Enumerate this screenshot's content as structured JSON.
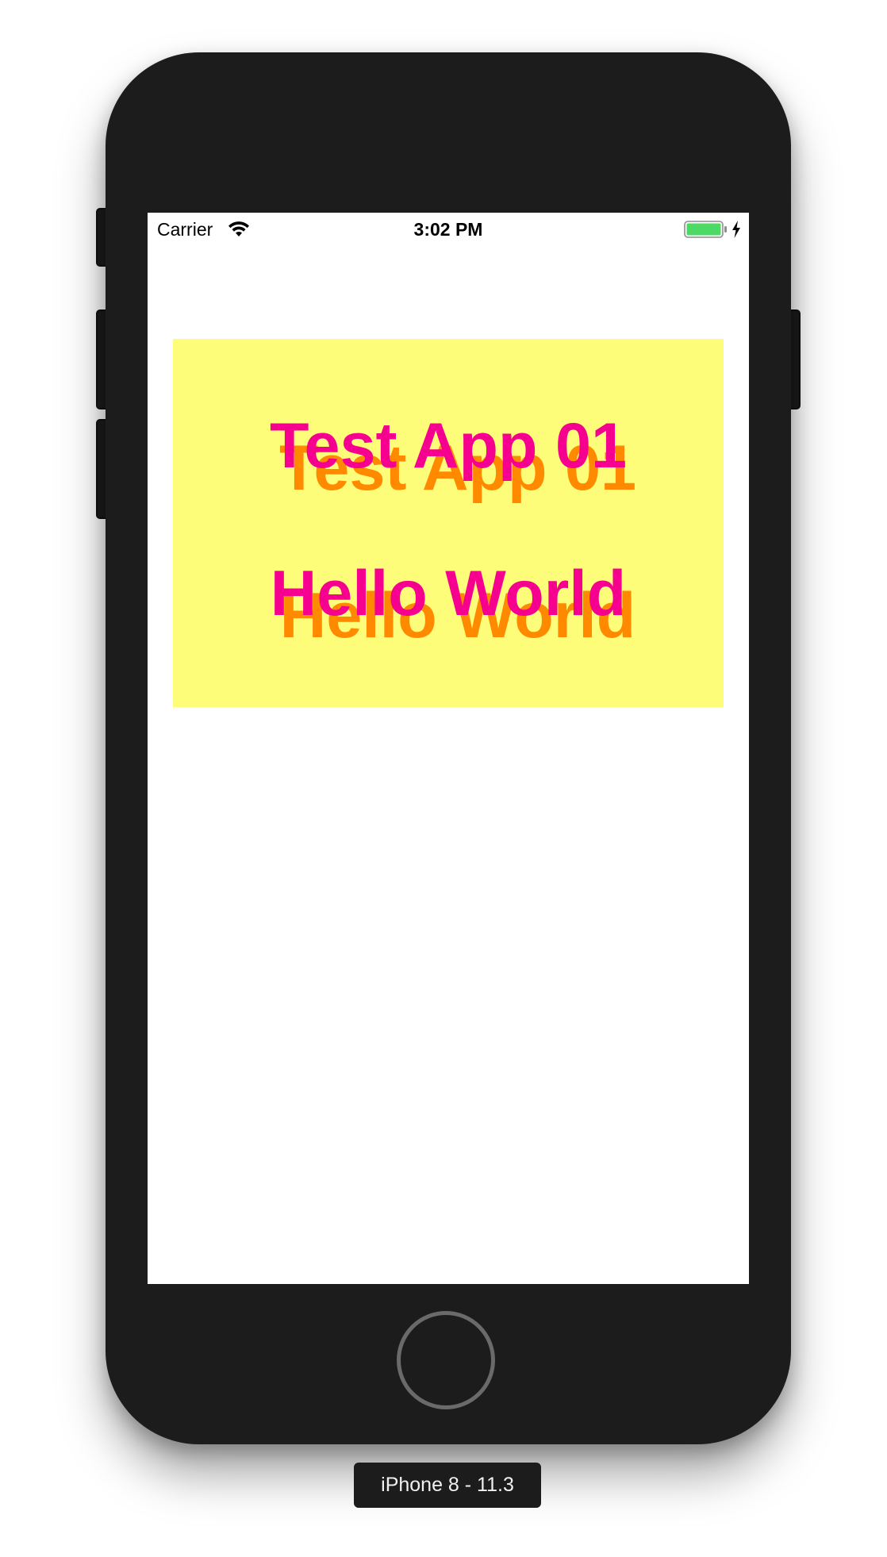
{
  "status_bar": {
    "carrier": "Carrier",
    "time": "3:02 PM",
    "battery_color": "#4cd964"
  },
  "app": {
    "title": "Test App 01",
    "subtitle": "Hello World",
    "box_color": "#fdfd7a",
    "primary_text_color": "#f5008f",
    "shadow_text_color": "#ff8a00"
  },
  "device": {
    "label": "iPhone 8 - 11.3"
  },
  "icons": {
    "wifi": "wifi-icon",
    "battery": "battery-icon",
    "charging": "charging-bolt-icon",
    "home": "home-button"
  }
}
